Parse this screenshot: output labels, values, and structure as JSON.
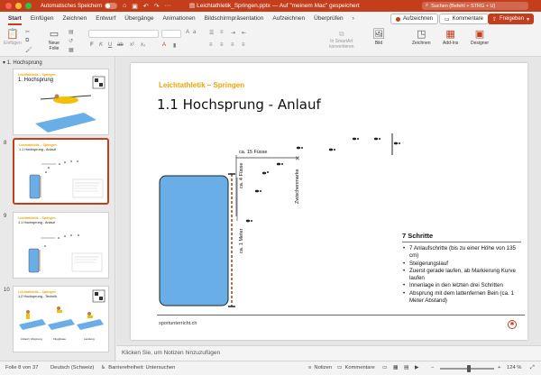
{
  "titlebar": {
    "autosave_label": "Automatisches Speichern",
    "doc_title": "Leichtathletik_Springen.pptx",
    "location": "— Auf \"meinem Mac\" gespeichert",
    "search_placeholder": "Suchen (Befehl + STRG + U)"
  },
  "tabs": [
    "Start",
    "Einfügen",
    "Zeichnen",
    "Entwurf",
    "Übergänge",
    "Animationen",
    "Bildschirmpräsentation",
    "Aufzeichnen",
    "Überprüfen"
  ],
  "ribbon_buttons": {
    "record": "Aufzeichnen",
    "comments": "Kommentare",
    "share": "Freigeben"
  },
  "toolbar": {
    "paste": "Einfügen",
    "new_slide_line1": "Neue",
    "new_slide_line2": "Folie",
    "smartart_line1": "In SmartArt",
    "smartart_line2": "konvertieren",
    "picture": "Bild",
    "draw": "Zeichnen",
    "addins": "Add-Ins",
    "designer": "Designer"
  },
  "thumbnails": {
    "section": "1. Hochsprung",
    "slides": [
      {
        "number": "",
        "sup": "Leichtathletik – Springen",
        "title": "1. Hochsprung"
      },
      {
        "number": "8",
        "sup": "Leichtathletik – Springen",
        "title": "1.1 Hochsprung - Anlauf"
      },
      {
        "number": "9",
        "sup": "Leichtathletik – Springen",
        "title": "1.1 Hochsprung - Anlauf"
      },
      {
        "number": "10",
        "sup": "Leichtathletik – Springen",
        "title": "1.2 Hochsprung - Technik"
      }
    ]
  },
  "slide": {
    "sup": "Leichtathletik – Springen",
    "title": "1.1 Hochsprung - Anlauf",
    "labels": {
      "fifteen_feet": "ca. 15 Füsse",
      "four_feet": "ca. 4 Füsse",
      "one_meter": "ca. 1 Meter",
      "intermediate_mark": "Zwischenmarke"
    },
    "steps_heading": "7 Schritte",
    "steps": [
      "7 Anlaufschritte (bis zu einer Höhe von 135 cm)",
      "Steigerungslauf",
      "Zuerst gerade laufen, ab Markierung Kurve laufen",
      "Innenlage in den letzten drei Schritten",
      "Absprung mit dem lattenfernen Bein (ca. 1 Meter Abstand)"
    ],
    "footer_site": "sportunterricht.ch"
  },
  "notes_placeholder": "Klicken Sie, um Notizen hinzuzufügen",
  "status": {
    "slide_info": "Folie 8 von 37",
    "language": "Deutsch (Schweiz)",
    "accessibility": "Barrierefreiheit: Untersuchen",
    "notes": "Notizen",
    "comments": "Kommentare",
    "zoom": "124 %"
  },
  "colors": {
    "accent": "#c43e1c",
    "slide_accent": "#f0a400",
    "mat_blue": "#6aaee8"
  }
}
